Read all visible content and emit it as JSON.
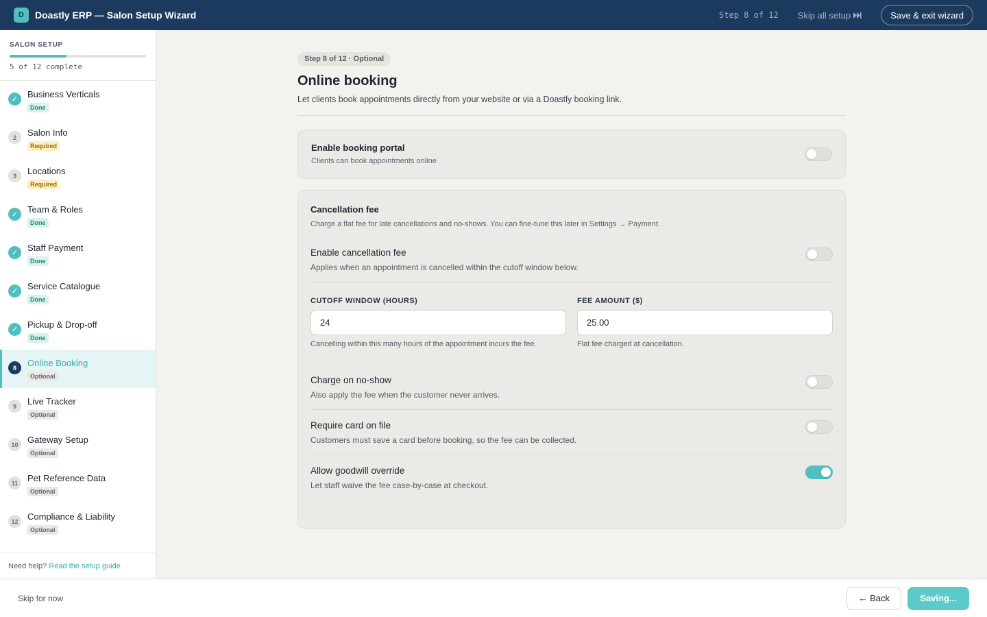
{
  "header": {
    "logo_letter": "D",
    "app_title": "Doastly ERP — Salon Setup Wizard",
    "step_counter": "Step 8 of 12",
    "skip_all_label": "Skip all setup",
    "skip_all_icon": "fast-forward-icon",
    "save_exit_label": "Save & exit wizard"
  },
  "sidebar": {
    "progress_title": "SALON SETUP",
    "progress_fraction": 0.4167,
    "progress_text": "5 of 12 complete",
    "items": [
      {
        "marker": "✓",
        "label": "Business Verticals",
        "status": "Done"
      },
      {
        "marker": "2",
        "label": "Salon Info",
        "status": "Required"
      },
      {
        "marker": "3",
        "label": "Locations",
        "status": "Required"
      },
      {
        "marker": "✓",
        "label": "Team & Roles",
        "status": "Done"
      },
      {
        "marker": "✓",
        "label": "Staff Payment",
        "status": "Done"
      },
      {
        "marker": "✓",
        "label": "Service Catalogue",
        "status": "Done"
      },
      {
        "marker": "✓",
        "label": "Pickup & Drop-off",
        "status": "Done"
      },
      {
        "marker": "8",
        "label": "Online Booking",
        "status": "Optional"
      },
      {
        "marker": "9",
        "label": "Live Tracker",
        "status": "Optional"
      },
      {
        "marker": "10",
        "label": "Gateway Setup",
        "status": "Optional"
      },
      {
        "marker": "11",
        "label": "Pet Reference Data",
        "status": "Optional"
      },
      {
        "marker": "12",
        "label": "Compliance & Liability",
        "status": "Optional"
      }
    ],
    "help_prefix": "Need help?",
    "help_link": "Read the setup guide"
  },
  "main": {
    "step_pill": "Step 8 of 12 · Optional",
    "title": "Online booking",
    "subtitle": "Let clients book appointments directly from your website or via a Doastly booking link.",
    "portal": {
      "title": "Enable booking portal",
      "subtitle": "Clients can book appointments online",
      "enabled": false
    },
    "cancellation": {
      "title": "Cancellation fee",
      "description": "Charge a flat fee for late cancellations and no-shows. You can fine-tune this later in Settings → Payment.",
      "enable_title": "Enable cancellation fee",
      "enable_sub": "Applies when an appointment is cancelled within the cutoff window below.",
      "enable_on": false,
      "cutoff_label": "CUTOFF WINDOW (HOURS)",
      "cutoff_value": "24",
      "cutoff_help": "Cancelling within this many hours of the appointment incurs the fee.",
      "fee_label": "FEE AMOUNT ($)",
      "fee_value": "25.00",
      "fee_help": "Flat fee charged at cancellation.",
      "noshow_title": "Charge on no-show",
      "noshow_sub": "Also apply the fee when the customer never arrives.",
      "noshow_on": false,
      "card_title": "Require card on file",
      "card_sub": "Customers must save a card before booking, so the fee can be collected.",
      "card_on": false,
      "goodwill_title": "Allow goodwill override",
      "goodwill_sub": "Let staff waive the fee case-by-case at checkout.",
      "goodwill_on": true
    }
  },
  "footer": {
    "skip_label": "Skip for now",
    "back_label": "← Back",
    "saving_label": "Saving..."
  },
  "colors": {
    "navy": "#1c3a5e",
    "accent_teal": "#4fbfbf",
    "done_badge": "#d7f2ec",
    "required_badge": "#fcefc8"
  }
}
